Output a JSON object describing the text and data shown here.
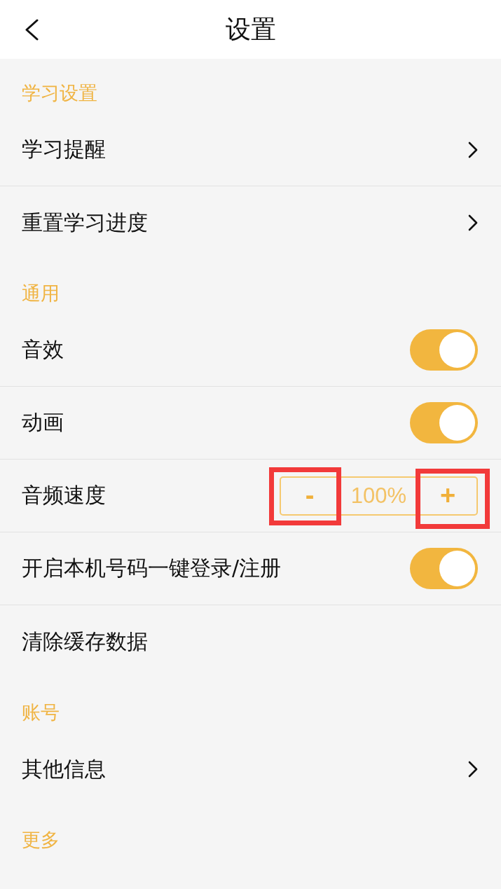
{
  "header": {
    "title": "设置"
  },
  "sections": [
    {
      "title": "学习设置",
      "items": [
        {
          "kind": "link",
          "label": "学习提醒"
        },
        {
          "kind": "link",
          "label": "重置学习进度"
        }
      ]
    },
    {
      "title": "通用",
      "items": [
        {
          "kind": "toggle",
          "label": "音效",
          "on": true
        },
        {
          "kind": "toggle",
          "label": "动画",
          "on": true
        },
        {
          "kind": "stepper",
          "label": "音频速度",
          "minus": {
            "label": "-",
            "highlighted": true
          },
          "value": "100%",
          "plus": {
            "label": "+",
            "highlighted": true
          }
        },
        {
          "kind": "toggle",
          "label": "开启本机号码一键登录/注册",
          "on": true
        },
        {
          "kind": "plain",
          "label": "清除缓存数据"
        }
      ]
    },
    {
      "title": "账号",
      "items": [
        {
          "kind": "link",
          "label": "其他信息"
        }
      ]
    },
    {
      "title": "更多"
    }
  ]
}
